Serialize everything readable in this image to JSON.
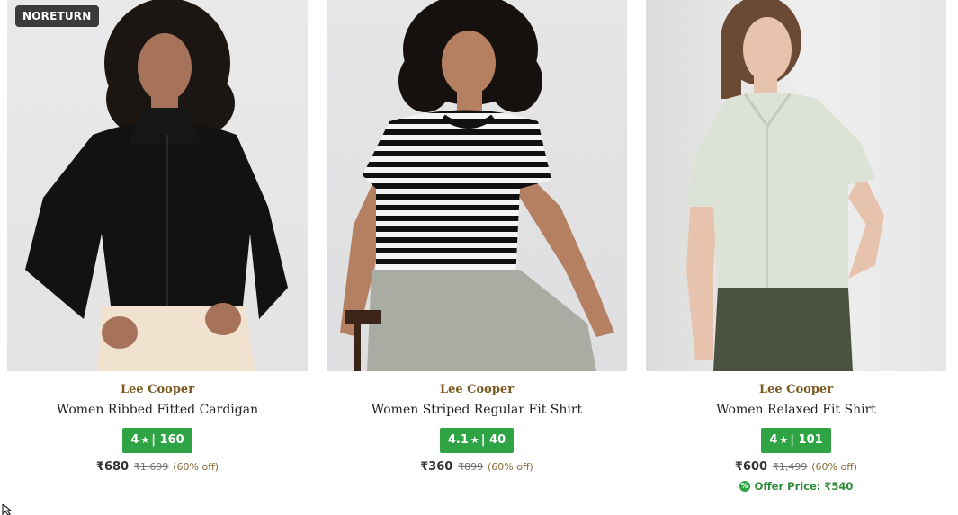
{
  "products": [
    {
      "badge": "NORETURN",
      "brand": "Lee Cooper",
      "title": "Women Ribbed Fitted Cardigan",
      "rating": "4",
      "reviews": "160",
      "price": "₹680",
      "mrp": "₹1,699",
      "discount": "(60% off)",
      "colors": {
        "garment": "#121212",
        "pants": "#f0e2cf",
        "skin": "#a7725a"
      }
    },
    {
      "brand": "Lee Cooper",
      "title": "Women Striped Regular Fit Shirt",
      "rating": "4.1",
      "reviews": "40",
      "price": "₹360",
      "mrp": "₹899",
      "discount": "(60% off)",
      "colors": {
        "garment": "#111111",
        "pants": "#a8aca2",
        "skin": "#b58062"
      }
    },
    {
      "brand": "Lee Cooper",
      "title": "Women Relaxed Fit Shirt",
      "rating": "4",
      "reviews": "101",
      "price": "₹600",
      "mrp": "₹1,499",
      "discount": "(60% off)",
      "offer": "Offer Price: ₹540",
      "colors": {
        "garment": "#dde2d6",
        "pants": "#4b5241",
        "skin": "#e7c3ad"
      }
    }
  ],
  "rating_star": "★",
  "rating_separator": "|",
  "offer_icon_glyph": "%",
  "accent_colors": {
    "rating_bg": "#2ea444",
    "brand_text": "#7a5a20",
    "offer_text": "#2e8b3a"
  }
}
